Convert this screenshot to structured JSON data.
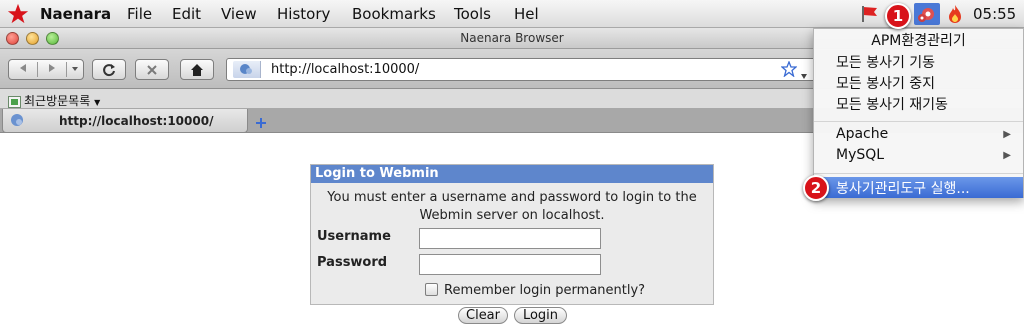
{
  "menubar": {
    "app_name": "Naenara",
    "items": [
      "File",
      "Edit",
      "View",
      "History",
      "Bookmarks",
      "Tools",
      "Hel"
    ],
    "clock": "05:55"
  },
  "window": {
    "title": "Naenara Browser"
  },
  "toolbar": {
    "url": "http://localhost:10000/"
  },
  "bookmarks_bar": {
    "folder_label": "최근방문목록"
  },
  "tabs": [
    {
      "label": "http://localhost:10000/"
    }
  ],
  "login": {
    "heading": "Login to Webmin",
    "message_line1": "You must enter a username and password to login to the",
    "message_line2": "Webmin server on localhost.",
    "username_label": "Username",
    "password_label": "Password",
    "username_value": "",
    "password_value": "",
    "remember_label": "Remember login permanently?",
    "clear_button": "Clear",
    "login_button": "Login"
  },
  "status_menu": {
    "title": "APM환경관리기",
    "items": [
      {
        "label": "모든 봉사기 기동"
      },
      {
        "label": "모든 봉사기 중지"
      },
      {
        "label": "모든 봉사기 재기동"
      },
      {
        "label": "Apache"
      },
      {
        "label": "MySQL"
      },
      {
        "label": "봉사기관리도구 실행..."
      }
    ]
  },
  "badges": {
    "first": "1",
    "second": "2"
  },
  "colors": {
    "accent": "#d8131a",
    "highlight": "#3a6bd3",
    "login_header": "#5e86cc"
  }
}
